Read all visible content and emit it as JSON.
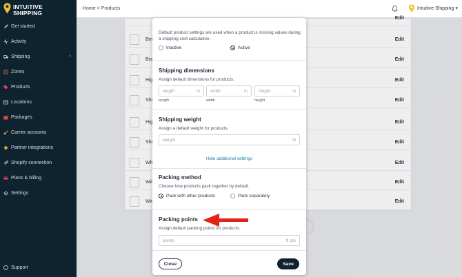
{
  "brand": {
    "line1": "INTUITIVE",
    "line2": "SHIPPING"
  },
  "sidebar": {
    "items": [
      {
        "label": "Get started",
        "icon": "rocket-icon"
      },
      {
        "label": "Activity",
        "icon": "activity-icon"
      },
      {
        "label": "Shipping",
        "icon": "truck-icon",
        "has_chevron": true
      },
      {
        "label": "Zones",
        "icon": "zones-icon"
      },
      {
        "label": "Products",
        "icon": "tag-icon"
      },
      {
        "label": "Locations",
        "icon": "map-pin-icon"
      },
      {
        "label": "Packages",
        "icon": "package-icon"
      },
      {
        "label": "Carrier accounts",
        "icon": "key-icon"
      },
      {
        "label": "Partner integrations",
        "icon": "puzzle-icon"
      },
      {
        "label": "Shopify connection",
        "icon": "link-icon"
      },
      {
        "label": "Plans & billing",
        "icon": "billing-icon"
      },
      {
        "label": "Settings",
        "icon": "gear-icon"
      }
    ],
    "support": "Support"
  },
  "topbar": {
    "breadcrumb": "Home > Products",
    "account_name": "Intuitive Shipping",
    "account_caret": "▾"
  },
  "products": {
    "rows": [
      {
        "name": "Bee",
        "edit": "Edit"
      },
      {
        "name": "Bra",
        "edit": "Edit"
      },
      {
        "name": "Hig",
        "edit": "Edit"
      },
      {
        "name": "Sho",
        "edit": "Edit"
      },
      {
        "name": "Hig",
        "edit": "Edit"
      },
      {
        "name": "She",
        "edit": "Edit"
      },
      {
        "name": "Wh",
        "edit": "Edit"
      },
      {
        "name": "Win",
        "edit": "Edit"
      },
      {
        "name": "Win",
        "edit": "Edit"
      }
    ],
    "top_edit": "Edit"
  },
  "modal": {
    "intro_line1": "Default product settings are used when a product is missing values during",
    "intro_line2": "a shipping cost calculation.",
    "status_inactive": "Inactive",
    "status_active": "Active",
    "dimensions": {
      "title": "Shipping dimensions",
      "desc": "Assign default dimensions for products.",
      "length_placeholder": "length",
      "width_placeholder": "width",
      "height_placeholder": "height",
      "unit": "in",
      "length_label": "length",
      "width_label": "width",
      "height_label": "height"
    },
    "weight": {
      "title": "Shipping weight",
      "desc": "Assign a default weight for products.",
      "placeholder": "weight",
      "unit": "lb"
    },
    "hide_link": "Hide additional settings",
    "packing": {
      "title": "Packing method",
      "desc": "Choose how products pack together by default.",
      "option_with_others": "Pack with other products",
      "option_separately": "Pack separately"
    },
    "points": {
      "title": "Packing points",
      "desc": "Assign default packing points for products.",
      "placeholder": "points",
      "unit": "pts"
    },
    "close_label": "Close",
    "save_label": "Save"
  },
  "colors": {
    "sidebar_bg": "#0f2230",
    "accent_link": "#1a7ea8",
    "arrow_red": "#e02418",
    "logo_yellow": "#f2c230"
  }
}
